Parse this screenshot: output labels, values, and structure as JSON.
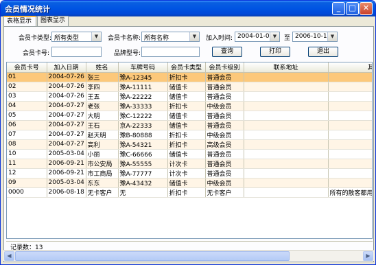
{
  "window": {
    "title": "会员情况统计",
    "min": "_",
    "max": "□",
    "close": "✕"
  },
  "tabs": [
    {
      "label": "表格显示"
    },
    {
      "label": "图表显示"
    }
  ],
  "filters": {
    "card_type_label": "会员卡类型:",
    "card_type_value": "所有类型",
    "card_name_label": "会员卡名称:",
    "card_name_value": "所有名称",
    "join_time_label": "加入时间:",
    "date_from": "2004-01-01",
    "to_label": "至",
    "date_to": "2006-10-12",
    "card_no_label": "会员卡号:",
    "card_no_value": "",
    "brand_label": "品牌型号:",
    "brand_value": "",
    "query_button": "查询",
    "print_button": "打印",
    "exit_button": "退出"
  },
  "table": {
    "columns": [
      "会员卡号",
      "加入日期",
      "姓名",
      "车牌号码",
      "会员卡类型",
      "会员卡级别",
      "联系地址",
      "其它信息"
    ],
    "rows": [
      [
        "01",
        "2004-07-26",
        "张三",
        "豫A-12345",
        "折扣卡",
        "普通会员",
        "",
        ""
      ],
      [
        "02",
        "2004-07-26",
        "李四",
        "豫A-11111",
        "储值卡",
        "普通会员",
        "",
        ""
      ],
      [
        "03",
        "2004-07-26",
        "王五",
        "豫A-22222",
        "储值卡",
        "普通会员",
        "",
        ""
      ],
      [
        "04",
        "2004-07-27",
        "老张",
        "豫A-33333",
        "折扣卡",
        "中级会员",
        "",
        ""
      ],
      [
        "05",
        "2004-07-27",
        "大明",
        "豫C-12222",
        "储值卡",
        "普通会员",
        "",
        ""
      ],
      [
        "06",
        "2004-07-27",
        "王石",
        "京A-22333",
        "储值卡",
        "普通会员",
        "",
        ""
      ],
      [
        "07",
        "2004-07-27",
        "赵天明",
        "豫B-80888",
        "折扣卡",
        "中级会员",
        "",
        ""
      ],
      [
        "08",
        "2004-07-27",
        "高利",
        "豫A-54321",
        "折扣卡",
        "高级会员",
        "",
        ""
      ],
      [
        "10",
        "2005-03-04",
        "小丽",
        "豫C-66666",
        "储值卡",
        "普通会员",
        "",
        ""
      ],
      [
        "11",
        "2006-09-21",
        "市公安局",
        "豫A-55555",
        "计次卡",
        "普通会员",
        "",
        ""
      ],
      [
        "12",
        "2006-09-21",
        "市工商局",
        "豫A-77777",
        "计次卡",
        "普通会员",
        "",
        ""
      ],
      [
        "09",
        "2005-03-04",
        "东东",
        "豫A-43432",
        "储值卡",
        "中级会员",
        "",
        ""
      ],
      [
        "0000",
        "2006-08-18",
        "无卡客户",
        "无",
        "折扣卡",
        "无卡客户",
        "",
        "所有的散客都用这"
      ]
    ]
  },
  "status": {
    "record_count": "记录数：13"
  },
  "scrollbar": {
    "left": "◀",
    "right": "▶"
  }
}
